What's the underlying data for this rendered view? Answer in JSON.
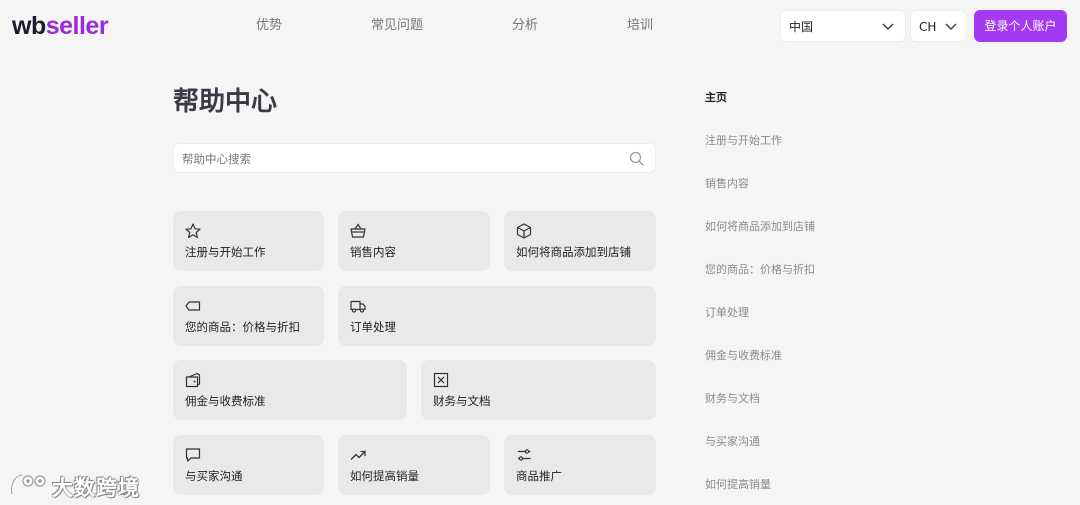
{
  "header": {
    "logo_wb": "wb",
    "logo_seller": "seller",
    "nav": [
      {
        "label": "优势"
      },
      {
        "label": "常见问题"
      },
      {
        "label": "分析"
      },
      {
        "label": "培训"
      }
    ],
    "country_value": "中国",
    "lang_value": "CH",
    "login_label": "登录个人账户"
  },
  "main": {
    "title": "帮助中心",
    "search_placeholder": "帮助中心搜索",
    "cards": [
      {
        "label": "注册与开始工作",
        "icon": "star-icon"
      },
      {
        "label": "销售内容",
        "icon": "basket-icon"
      },
      {
        "label": "如何将商品添加到店铺",
        "icon": "box-icon"
      },
      {
        "label": "您的商品：价格与折扣",
        "icon": "tag-icon"
      },
      {
        "label": "订单处理",
        "icon": "truck-icon"
      },
      {
        "label": "佣金与收费标准",
        "icon": "wallet-icon"
      },
      {
        "label": "财务与文档",
        "icon": "document-icon"
      },
      {
        "label": "与买家沟通",
        "icon": "chat-icon"
      },
      {
        "label": "如何提高销量",
        "icon": "trend-up-icon"
      },
      {
        "label": "商品推广",
        "icon": "promo-icon"
      }
    ]
  },
  "right_nav": {
    "items": [
      {
        "label": "主页"
      },
      {
        "label": "注册与开始工作"
      },
      {
        "label": "销售内容"
      },
      {
        "label": "如何将商品添加到店铺"
      },
      {
        "label": "您的商品：价格与折扣"
      },
      {
        "label": "订单处理"
      },
      {
        "label": "佣金与收费标准"
      },
      {
        "label": "财务与文档"
      },
      {
        "label": "与买家沟通"
      },
      {
        "label": "如何提高销量"
      }
    ]
  },
  "watermark": {
    "text": "大数跨境"
  },
  "colors": {
    "accent": "#a43bf3",
    "brand": "#9b2bd9",
    "card_bg": "#e9e9ec",
    "page_bg": "#f5f5f6"
  }
}
